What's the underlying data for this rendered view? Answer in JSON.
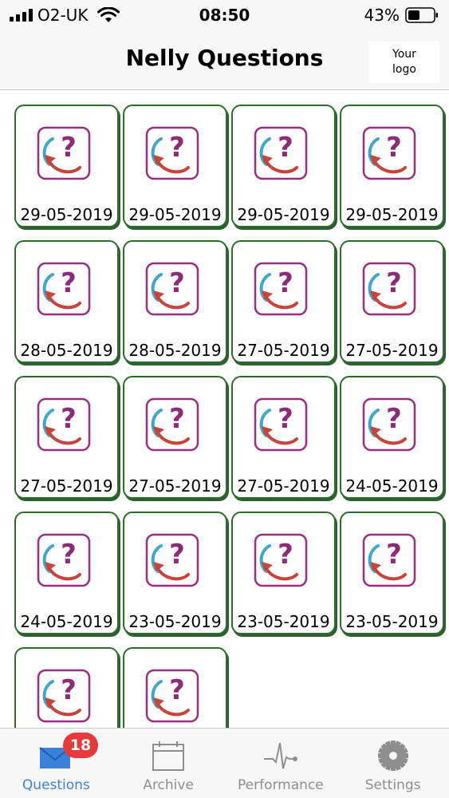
{
  "status_bar": {
    "carrier": "O2-UK",
    "time": "08:50",
    "battery": "43%"
  },
  "header": {
    "title": "Nelly Questions",
    "logo_line1": "Your",
    "logo_line2": "logo"
  },
  "questions": [
    {
      "date": "29-05-2019"
    },
    {
      "date": "29-05-2019"
    },
    {
      "date": "29-05-2019"
    },
    {
      "date": "29-05-2019"
    },
    {
      "date": "28-05-2019"
    },
    {
      "date": "28-05-2019"
    },
    {
      "date": "27-05-2019"
    },
    {
      "date": "27-05-2019"
    },
    {
      "date": "27-05-2019"
    },
    {
      "date": "27-05-2019"
    },
    {
      "date": "27-05-2019"
    },
    {
      "date": "24-05-2019"
    },
    {
      "date": "24-05-2019"
    },
    {
      "date": "23-05-2019"
    },
    {
      "date": "23-05-2019"
    },
    {
      "date": "23-05-2019"
    },
    {
      "date": ""
    },
    {
      "date": ""
    }
  ],
  "tab_bar": {
    "tabs": [
      {
        "label": "Questions",
        "icon": "envelope-icon",
        "badge": "18",
        "active": true
      },
      {
        "label": "Archive",
        "icon": "calendar-icon"
      },
      {
        "label": "Performance",
        "icon": "pulse-icon"
      },
      {
        "label": "Settings",
        "icon": "gear-icon"
      }
    ]
  },
  "colors": {
    "accent": "#3a82d9",
    "tile_border": "#2e6b2e",
    "badge": "#e83a3a",
    "icon_frame": "#9b2d7f"
  }
}
